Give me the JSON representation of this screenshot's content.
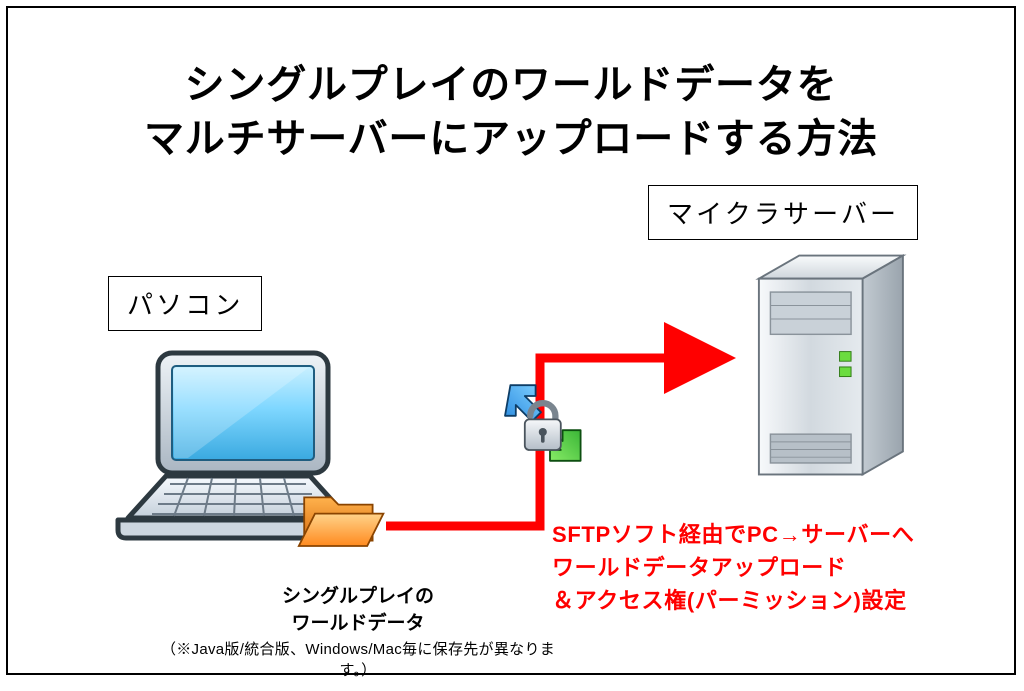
{
  "title_line1": "シングルプレイのワールドデータを",
  "title_line2": "マルチサーバーにアップロードする方法",
  "label_pc": "パソコン",
  "label_server": "マイクラサーバー",
  "caption_pc_line1": "シングルプレイの",
  "caption_pc_line2": "ワールドデータ",
  "caption_pc_note": "（※Java版/統合版、Windows/Mac毎に保存先が異なります。）",
  "red_line1": "SFTPソフト経由でPC→サーバーへ",
  "red_line2": "ワールドデータアップロード",
  "red_line3": "＆アクセス権(パーミッション)設定",
  "colors": {
    "arrow": "#ff0000",
    "folder": "#ff8a1f",
    "screen": "#7fd7ff",
    "server_led": "#6bdc3f"
  }
}
